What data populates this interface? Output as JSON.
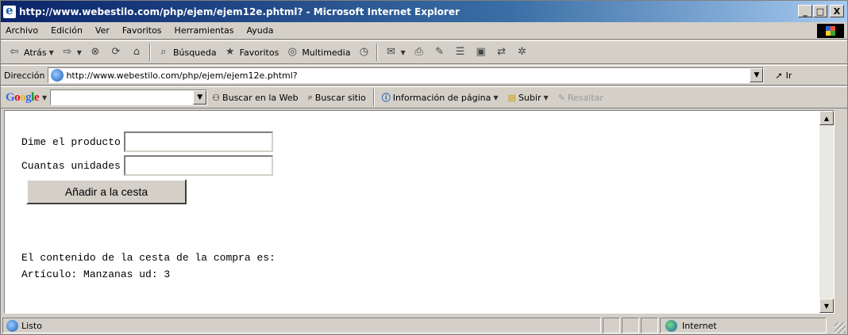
{
  "window": {
    "title": "http://www.webestilo.com/php/ejem/ejem12e.phtml? - Microsoft Internet Explorer",
    "minimize": "_",
    "maximize": "□",
    "close": "X"
  },
  "menu": {
    "items": [
      {
        "label": "Archivo"
      },
      {
        "label": "Edición"
      },
      {
        "label": "Ver"
      },
      {
        "label": "Favoritos"
      },
      {
        "label": "Herramientas"
      },
      {
        "label": "Ayuda"
      }
    ]
  },
  "toolbar": {
    "back": "Atrás",
    "search": "Búsqueda",
    "favorites": "Favoritos",
    "media": "Multimedia"
  },
  "address": {
    "label": "Dirección",
    "url": "http://www.webestilo.com/php/ejem/ejem12e.phtml?",
    "go": "Ir"
  },
  "google": {
    "search_value": "",
    "search_web": "Buscar en la Web",
    "search_site": "Buscar sitio",
    "page_info": "Información de página",
    "up": "Subir",
    "highlight": "Resaltar"
  },
  "page": {
    "product_label": "Dime el producto",
    "product_value": "",
    "units_label": "Cuantas unidades",
    "units_value": "",
    "submit_label": "Añadir a la cesta",
    "cart_heading": "El contenido de la cesta de la compra es:",
    "cart_item": "Artículo: Manzanas ud: 3"
  },
  "status": {
    "text": "Listo",
    "zone": "Internet"
  },
  "icons": [
    "ie-icon",
    "back-icon",
    "forward-icon",
    "stop-icon",
    "refresh-icon",
    "home-icon",
    "search-icon",
    "favorites-icon",
    "media-icon",
    "history-icon",
    "mail-icon",
    "print-icon",
    "edit-icon",
    "discuss-icon",
    "messenger-icon",
    "go-icon",
    "globe-icon"
  ]
}
